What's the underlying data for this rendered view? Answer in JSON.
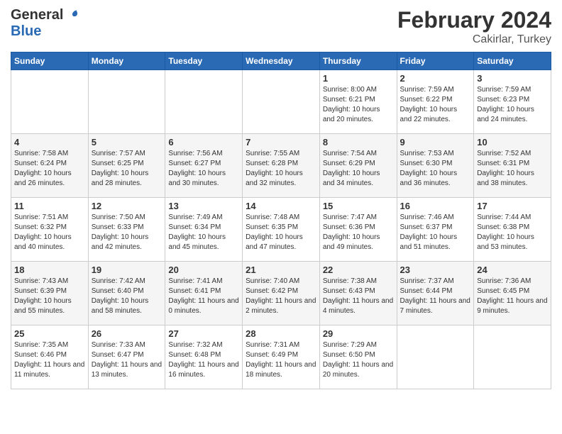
{
  "header": {
    "logo_general": "General",
    "logo_blue": "Blue",
    "month_year": "February 2024",
    "location": "Cakirlar, Turkey"
  },
  "days_of_week": [
    "Sunday",
    "Monday",
    "Tuesday",
    "Wednesday",
    "Thursday",
    "Friday",
    "Saturday"
  ],
  "weeks": [
    [
      {
        "day": "",
        "info": ""
      },
      {
        "day": "",
        "info": ""
      },
      {
        "day": "",
        "info": ""
      },
      {
        "day": "",
        "info": ""
      },
      {
        "day": "1",
        "info": "Sunrise: 8:00 AM\nSunset: 6:21 PM\nDaylight: 10 hours\nand 20 minutes."
      },
      {
        "day": "2",
        "info": "Sunrise: 7:59 AM\nSunset: 6:22 PM\nDaylight: 10 hours\nand 22 minutes."
      },
      {
        "day": "3",
        "info": "Sunrise: 7:59 AM\nSunset: 6:23 PM\nDaylight: 10 hours\nand 24 minutes."
      }
    ],
    [
      {
        "day": "4",
        "info": "Sunrise: 7:58 AM\nSunset: 6:24 PM\nDaylight: 10 hours\nand 26 minutes."
      },
      {
        "day": "5",
        "info": "Sunrise: 7:57 AM\nSunset: 6:25 PM\nDaylight: 10 hours\nand 28 minutes."
      },
      {
        "day": "6",
        "info": "Sunrise: 7:56 AM\nSunset: 6:27 PM\nDaylight: 10 hours\nand 30 minutes."
      },
      {
        "day": "7",
        "info": "Sunrise: 7:55 AM\nSunset: 6:28 PM\nDaylight: 10 hours\nand 32 minutes."
      },
      {
        "day": "8",
        "info": "Sunrise: 7:54 AM\nSunset: 6:29 PM\nDaylight: 10 hours\nand 34 minutes."
      },
      {
        "day": "9",
        "info": "Sunrise: 7:53 AM\nSunset: 6:30 PM\nDaylight: 10 hours\nand 36 minutes."
      },
      {
        "day": "10",
        "info": "Sunrise: 7:52 AM\nSunset: 6:31 PM\nDaylight: 10 hours\nand 38 minutes."
      }
    ],
    [
      {
        "day": "11",
        "info": "Sunrise: 7:51 AM\nSunset: 6:32 PM\nDaylight: 10 hours\nand 40 minutes."
      },
      {
        "day": "12",
        "info": "Sunrise: 7:50 AM\nSunset: 6:33 PM\nDaylight: 10 hours\nand 42 minutes."
      },
      {
        "day": "13",
        "info": "Sunrise: 7:49 AM\nSunset: 6:34 PM\nDaylight: 10 hours\nand 45 minutes."
      },
      {
        "day": "14",
        "info": "Sunrise: 7:48 AM\nSunset: 6:35 PM\nDaylight: 10 hours\nand 47 minutes."
      },
      {
        "day": "15",
        "info": "Sunrise: 7:47 AM\nSunset: 6:36 PM\nDaylight: 10 hours\nand 49 minutes."
      },
      {
        "day": "16",
        "info": "Sunrise: 7:46 AM\nSunset: 6:37 PM\nDaylight: 10 hours\nand 51 minutes."
      },
      {
        "day": "17",
        "info": "Sunrise: 7:44 AM\nSunset: 6:38 PM\nDaylight: 10 hours\nand 53 minutes."
      }
    ],
    [
      {
        "day": "18",
        "info": "Sunrise: 7:43 AM\nSunset: 6:39 PM\nDaylight: 10 hours\nand 55 minutes."
      },
      {
        "day": "19",
        "info": "Sunrise: 7:42 AM\nSunset: 6:40 PM\nDaylight: 10 hours\nand 58 minutes."
      },
      {
        "day": "20",
        "info": "Sunrise: 7:41 AM\nSunset: 6:41 PM\nDaylight: 11 hours\nand 0 minutes."
      },
      {
        "day": "21",
        "info": "Sunrise: 7:40 AM\nSunset: 6:42 PM\nDaylight: 11 hours\nand 2 minutes."
      },
      {
        "day": "22",
        "info": "Sunrise: 7:38 AM\nSunset: 6:43 PM\nDaylight: 11 hours\nand 4 minutes."
      },
      {
        "day": "23",
        "info": "Sunrise: 7:37 AM\nSunset: 6:44 PM\nDaylight: 11 hours\nand 7 minutes."
      },
      {
        "day": "24",
        "info": "Sunrise: 7:36 AM\nSunset: 6:45 PM\nDaylight: 11 hours\nand 9 minutes."
      }
    ],
    [
      {
        "day": "25",
        "info": "Sunrise: 7:35 AM\nSunset: 6:46 PM\nDaylight: 11 hours\nand 11 minutes."
      },
      {
        "day": "26",
        "info": "Sunrise: 7:33 AM\nSunset: 6:47 PM\nDaylight: 11 hours\nand 13 minutes."
      },
      {
        "day": "27",
        "info": "Sunrise: 7:32 AM\nSunset: 6:48 PM\nDaylight: 11 hours\nand 16 minutes."
      },
      {
        "day": "28",
        "info": "Sunrise: 7:31 AM\nSunset: 6:49 PM\nDaylight: 11 hours\nand 18 minutes."
      },
      {
        "day": "29",
        "info": "Sunrise: 7:29 AM\nSunset: 6:50 PM\nDaylight: 11 hours\nand 20 minutes."
      },
      {
        "day": "",
        "info": ""
      },
      {
        "day": "",
        "info": ""
      }
    ]
  ]
}
